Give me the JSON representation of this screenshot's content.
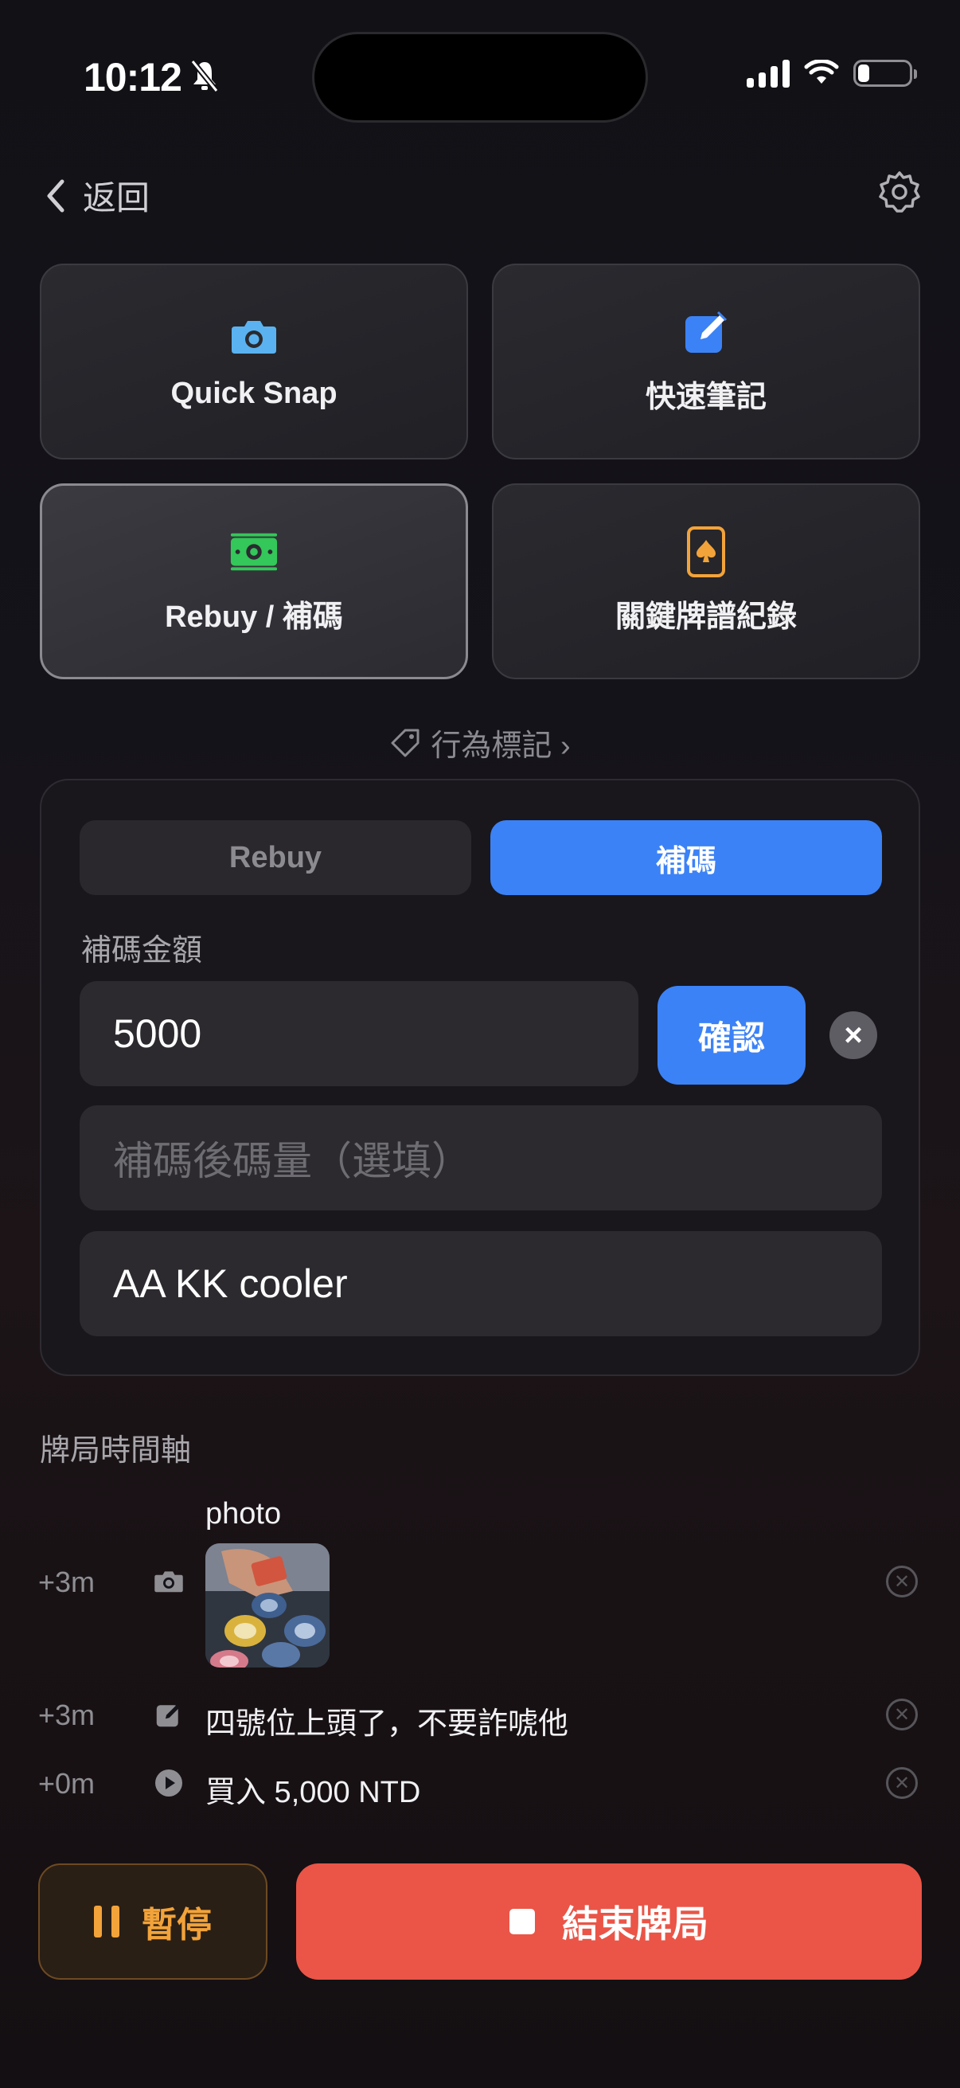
{
  "status": {
    "time": "10:12"
  },
  "nav": {
    "back_label": "返回"
  },
  "tiles": [
    {
      "label": "Quick Snap",
      "icon": "camera-icon"
    },
    {
      "label": "快速筆記",
      "icon": "note-edit-icon"
    },
    {
      "label": "Rebuy / 補碼",
      "icon": "cash-icon"
    },
    {
      "label": "關鍵牌譜紀錄",
      "icon": "spade-card-icon"
    }
  ],
  "behavior_tag": {
    "label": "行為標記 ›"
  },
  "panel": {
    "segments": {
      "rebuy": "Rebuy",
      "topup": "補碼"
    },
    "amount_label": "補碼金額",
    "amount_value": "5000",
    "confirm_label": "確認",
    "stack_placeholder": "補碼後碼量（選填）",
    "note_value": "AA KK cooler"
  },
  "timeline": {
    "title": "牌局時間軸",
    "items": [
      {
        "time": "+3m",
        "type": "photo",
        "text": "photo",
        "icon": "camera-icon"
      },
      {
        "time": "+3m",
        "type": "note",
        "text": "四號位上頭了，不要詐唬他",
        "icon": "note-edit-icon"
      },
      {
        "time": "+0m",
        "type": "buyin",
        "text": "買入 5,000 NTD",
        "icon": "play-icon"
      }
    ]
  },
  "actions": {
    "pause_label": "暫停",
    "end_label": "結束牌局"
  },
  "colors": {
    "accent_blue": "#3b82f6",
    "end_red": "#ea5547",
    "pause_orange": "#f2a33a",
    "cash_green": "#34c759"
  }
}
